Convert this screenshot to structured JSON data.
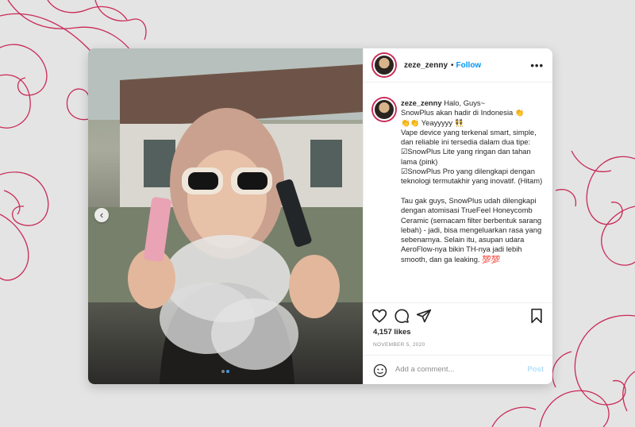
{
  "colors": {
    "brand_red": "#c92a57",
    "link_blue": "#0095f6",
    "post_disabled": "#b2dffc",
    "card_bg": "#ffffff",
    "page_bg": "#e4e4e4"
  },
  "post": {
    "header": {
      "username": "zeze_zenny",
      "separator": "•",
      "follow_label": "Follow",
      "more_icon": "more-horizontal-icon"
    },
    "caption": {
      "username": "zeze_zenny",
      "text": " Halo, Guys~\nSnowPlus akan hadir di Indonesia 👏\n👏👏 Yeayyyyy 👯\nVape device yang terkenal smart, simple, dan reliable ini tersedia dalam dua tipe:\n☑SnowPlus Lite yang ringan dan tahan lama (pink)\n☑SnowPlus Pro yang dilengkapi dengan teknologi termutakhir yang inovatif. (Hitam)\n\nTau gak guys, SnowPlus udah dilengkapi dengan atomisasi TrueFeel Honeycomb Ceramic (semacam filter berbentuk sarang lebah) - jadi, bisa mengeluarkan rasa yang sebenarnya. Selain itu, asupan udara AeroFlow-nya bikin TH-nya jadi lebih smooth, dan ga leaking. 💯💯"
    },
    "actions": {
      "like_icon": "heart-icon",
      "comment_icon": "comment-icon",
      "share_icon": "send-icon",
      "save_icon": "bookmark-icon"
    },
    "likes": "4,157 likes",
    "date": "NOVEMBER 5, 2020",
    "add_comment": {
      "placeholder": "Add a comment...",
      "emoji_icon": "smiley-icon",
      "post_label": "Post"
    },
    "carousel": {
      "prev_icon": "chevron-left-icon",
      "slide_count": 2,
      "active_slide": 2
    }
  }
}
